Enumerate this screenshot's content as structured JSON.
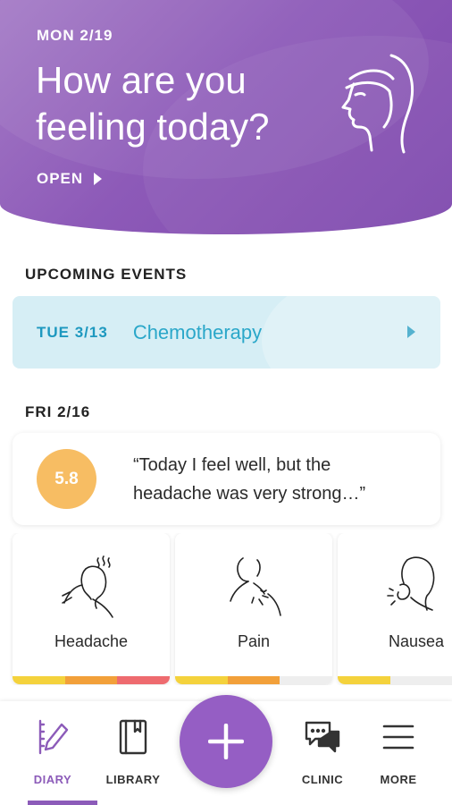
{
  "header": {
    "date": "MON 2/19",
    "headline": "How are you feeling today?",
    "open_label": "OPEN"
  },
  "upcoming": {
    "title": "UPCOMING EVENTS",
    "event": {
      "date": "TUE 3/13",
      "name": "Chemotherapy"
    }
  },
  "entry": {
    "date": "FRI 2/16",
    "score": "5.8",
    "quote": "“Today I feel well, but the headache was very strong…”"
  },
  "symptoms": [
    {
      "label": "Headache",
      "icon": "headache-icon",
      "level_colors": [
        "#f4d23c",
        "#f2a03a",
        "#ee6b6f"
      ]
    },
    {
      "label": "Pain",
      "icon": "pain-icon",
      "level_colors": [
        "#f4d23c",
        "#f2a03a",
        "#eeeeee"
      ]
    },
    {
      "label": "Nausea",
      "icon": "nausea-icon",
      "level_colors": [
        "#f4d23c",
        "#eeeeee",
        "#eeeeee"
      ]
    }
  ],
  "nav": {
    "diary": "DIARY",
    "library": "LIBRARY",
    "clinic": "CLINIC",
    "more": "MORE"
  },
  "colors": {
    "brand_purple": "#8c5bb9",
    "event_blue": "#1d98bf",
    "score_orange": "#f7bd63"
  }
}
